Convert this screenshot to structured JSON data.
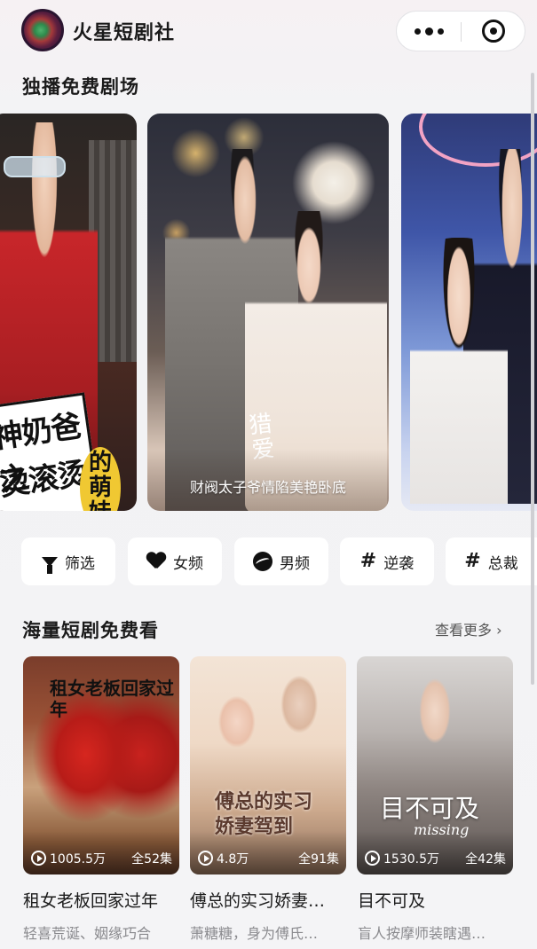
{
  "header": {
    "app_name": "火星短剧社",
    "avatar_icon": "mars-logo",
    "more_icon": "more-dots-icon",
    "close_icon": "target-circle-icon"
  },
  "featured": {
    "title": "独播免费剧场",
    "cards": [
      {
        "art_line1": "神奶爸之",
        "art_line2": "烫滚烫",
        "badge": "的萌娃"
      },
      {
        "art_title": "猎爱",
        "caption": "财阀太子爷情陷美艳卧底"
      },
      {
        "art": ""
      }
    ]
  },
  "filters": [
    {
      "label": "筛选",
      "icon": "filter-funnel-icon"
    },
    {
      "label": "女频",
      "icon": "heart-icon"
    },
    {
      "label": "男频",
      "icon": "ball-icon"
    },
    {
      "label": "逆袭",
      "icon": "hash-icon"
    },
    {
      "label": "总裁",
      "icon": "hash-icon"
    }
  ],
  "grid": {
    "title": "海量短剧免费看",
    "more": "查看更多",
    "items": [
      {
        "title": "租女老板回家过年",
        "desc": "轻喜荒诞、姻缘巧合",
        "views": "1005.5万",
        "episodes": "全52集",
        "art": "租女老板回家过年"
      },
      {
        "title": "傅总的实习娇妻…",
        "desc": "萧糖糖，身为傅氏…",
        "views": "4.8万",
        "episodes": "全91集",
        "art": "傅总的实习娇妻驾到"
      },
      {
        "title": "目不可及",
        "desc": "盲人按摩师装瞎遇…",
        "views": "1530.5万",
        "episodes": "全42集",
        "art": "目不可及",
        "art_sub": "missing"
      }
    ]
  }
}
